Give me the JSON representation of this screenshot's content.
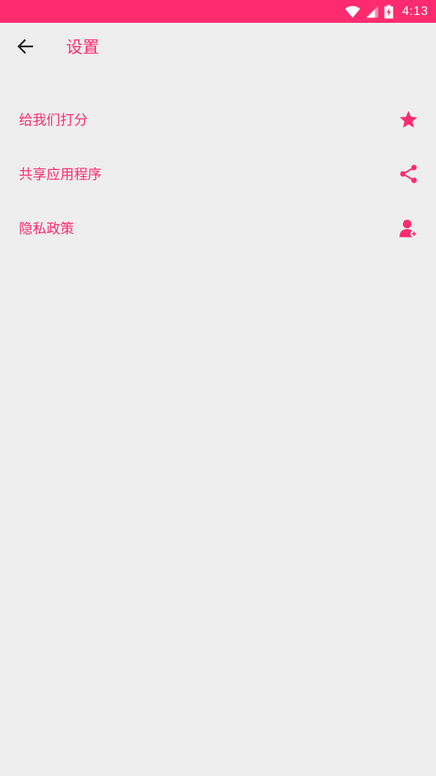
{
  "status_bar": {
    "time": "4:13",
    "icons": [
      "wifi-icon",
      "signal-icon",
      "battery-icon"
    ],
    "background_color": "#fe2b6f"
  },
  "toolbar": {
    "back_icon": "arrow-back-icon",
    "title": "设置"
  },
  "settings": {
    "items": [
      {
        "label": "给我们打分",
        "icon": "star-icon"
      },
      {
        "label": "共享应用程序",
        "icon": "share-icon"
      },
      {
        "label": "隐私政策",
        "icon": "person-add-icon"
      }
    ]
  },
  "colors": {
    "accent": "#fe2b6f",
    "background": "#eeeeee",
    "icon_dark": "#222222"
  }
}
